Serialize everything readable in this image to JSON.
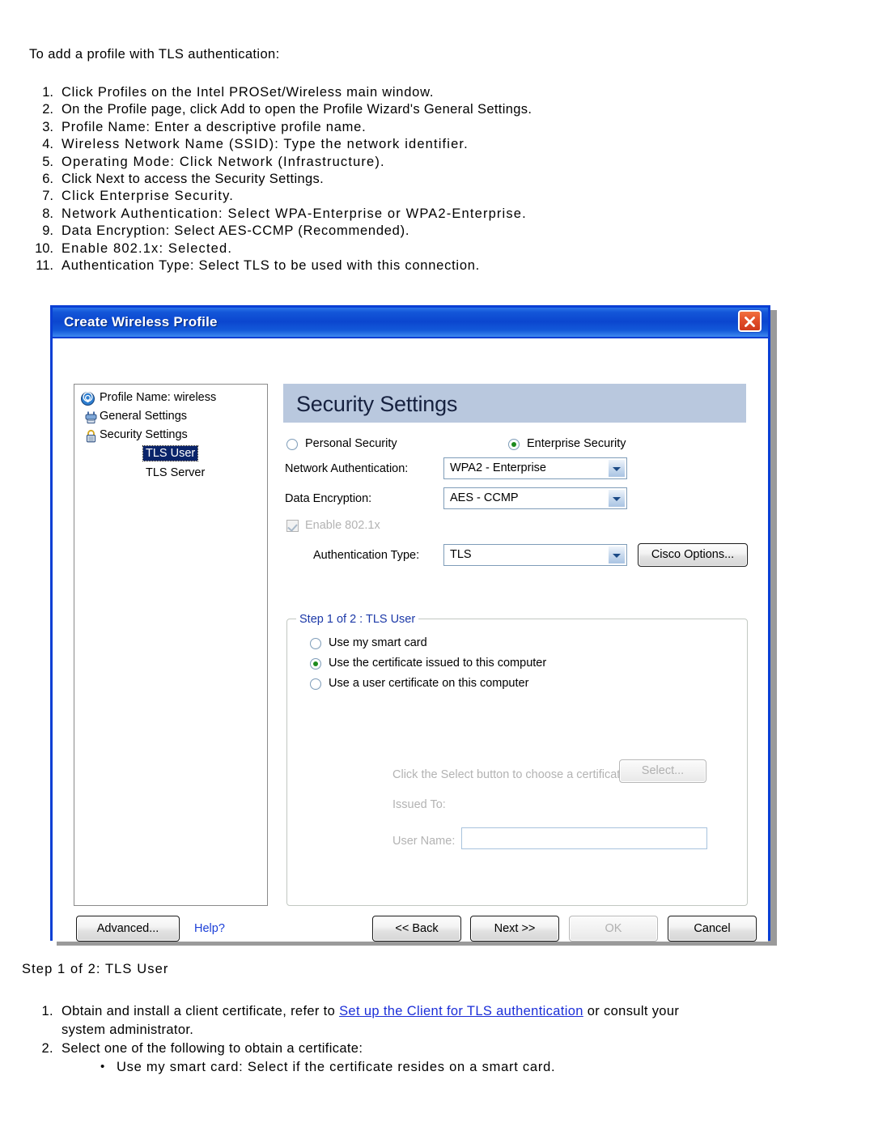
{
  "doc": {
    "intro": "To add a profile with TLS authentication:",
    "steps": [
      {
        "num": "1.",
        "text": "Click Profiles on the Intel PROSet/Wireless main window."
      },
      {
        "num": "2.",
        "text": "On the Profile page, click Add to open the Profile Wizard's General Settings."
      },
      {
        "num": "3.",
        "text": "Profile Name: Enter a descriptive profile name."
      },
      {
        "num": "4.",
        "text": "Wireless Network Name (SSID): Type the network identifier."
      },
      {
        "num": "5.",
        "text": "Operating Mode: Click Network (Infrastructure)."
      },
      {
        "num": "6.",
        "text": "Click Next to access the Security Settings."
      },
      {
        "num": "7.",
        "text": "Click Enterprise Security."
      },
      {
        "num": "8.",
        "text": "Network Authentication: Select WPA-Enterprise or WPA2-Enterprise."
      },
      {
        "num": "9.",
        "text": "Data Encryption: Select AES-CCMP (Recommended)."
      },
      {
        "num": "10.",
        "text": "Enable 802.1x: Selected."
      },
      {
        "num": "11.",
        "text": "Authentication Type: Select TLS to be used with this connection."
      }
    ]
  },
  "dialog": {
    "title": "Create Wireless Profile",
    "close_icon": "close-icon",
    "tree": {
      "items": [
        {
          "label": "Profile Name: wireless",
          "icon": "wireless-globe-icon",
          "selected": false
        },
        {
          "label": "General Settings",
          "icon": "general-settings-icon",
          "selected": false
        },
        {
          "label": "Security Settings",
          "icon": "padlock-icon",
          "selected": false
        },
        {
          "label": "TLS User",
          "icon": "",
          "selected": true
        },
        {
          "label": "TLS Server",
          "icon": "",
          "selected": false
        }
      ]
    },
    "pane": {
      "header": "Security Settings",
      "security_mode": {
        "personal_label": "Personal Security",
        "personal_selected": false,
        "enterprise_label": "Enterprise Security",
        "enterprise_selected": true
      },
      "network_auth": {
        "label": "Network Authentication:",
        "value": "WPA2 - Enterprise"
      },
      "data_encryption": {
        "label": "Data Encryption:",
        "value": "AES - CCMP"
      },
      "enable_8021x": {
        "label": "Enable 802.1x",
        "checked": true,
        "disabled": true
      },
      "auth_type": {
        "label": "Authentication Type:",
        "value": "TLS"
      },
      "cisco_options_label": "Cisco Options...",
      "groupbox": {
        "title": "Step 1 of 2 : TLS User",
        "options": [
          {
            "label": "Use my smart card",
            "selected": false
          },
          {
            "label": "Use the certificate issued to this computer",
            "selected": true
          },
          {
            "label": "Use a user certificate on this computer",
            "selected": false
          }
        ],
        "select_prompt": "Click the Select button to choose a certificate:",
        "select_button": "Select...",
        "issued_to_label": "Issued To:",
        "issued_to_value": "",
        "user_name_label": "User Name:",
        "user_name_value": ""
      }
    },
    "footer": {
      "advanced_label": "Advanced...",
      "help_label": "Help?",
      "back_label": "<< Back",
      "next_label": "Next >>",
      "ok_label": "OK",
      "cancel_label": "Cancel"
    }
  },
  "below": {
    "heading": "Step 1 of 2: TLS User",
    "item1_prefix": "Obtain and install a client certificate, refer to ",
    "item1_link": "Set up the Client for TLS authentication",
    "item1_suffix": " or consult your",
    "item1_line2": "system administrator.",
    "item1_num": "1.",
    "item2_num": "2.",
    "item2_text": "Select one of the following to obtain a certificate:",
    "bullet1": "Use my smart card: Select if the certificate resides on a smart card."
  }
}
